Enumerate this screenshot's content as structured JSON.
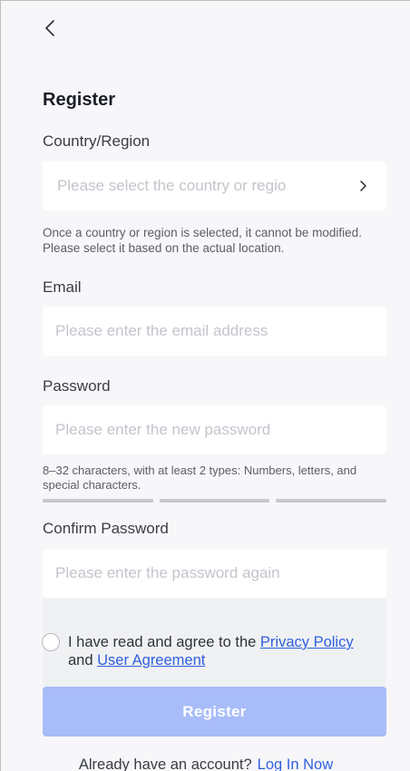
{
  "header": {
    "back_icon": "chevron-left-icon"
  },
  "page": {
    "title": "Register"
  },
  "country": {
    "label": "Country/Region",
    "placeholder": "Please select the country or regio",
    "chevron_icon": "chevron-right-icon",
    "hint": "Once a country or region is selected, it cannot be modified. Please select it based on the actual location."
  },
  "email": {
    "label": "Email",
    "placeholder": "Please enter the email address",
    "value": ""
  },
  "password": {
    "label": "Password",
    "placeholder": "Please enter the new password",
    "value": "",
    "hint": "8–32 characters, with at least 2 types: Numbers, letters, and special characters.",
    "strength_segments_filled": 0,
    "strength_segments_total": 3
  },
  "confirm": {
    "label": "Confirm Password",
    "placeholder": "Please enter the password again",
    "value": ""
  },
  "agreement": {
    "checked": false,
    "prefix": "I have read and agree to the ",
    "privacy_label": "Privacy Policy",
    "conjunction": "and ",
    "user_agreement_label": "User Agreement"
  },
  "actions": {
    "register_label": "Register"
  },
  "footer": {
    "question": "Already have an account?",
    "login_label": "Log In Now"
  },
  "colors": {
    "accent": "#2f5fe0",
    "button_disabled": "#a8bcf9",
    "background": "#f7f7f9"
  }
}
